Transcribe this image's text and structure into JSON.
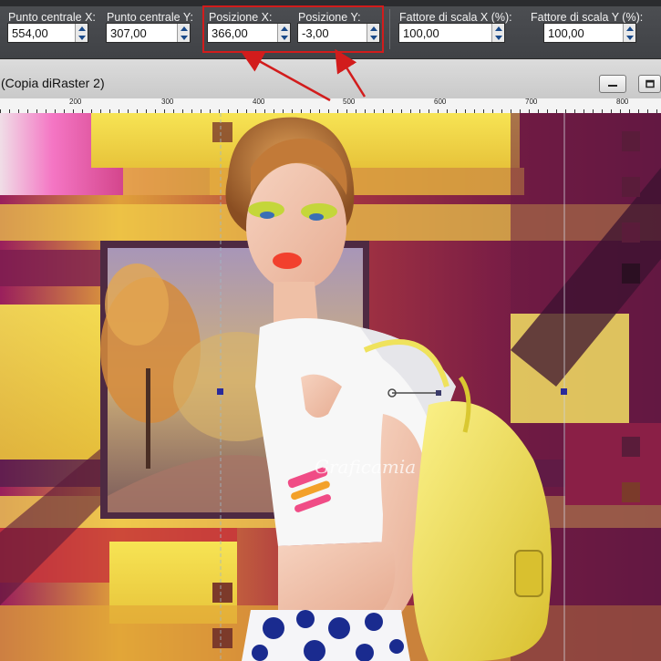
{
  "tool_options": {
    "center_x": {
      "label": "Punto centrale X:",
      "value": "554,00"
    },
    "center_y": {
      "label": "Punto centrale Y:",
      "value": "307,00"
    },
    "position_x": {
      "label": "Posizione X:",
      "value": "366,00"
    },
    "position_y": {
      "label": "Posizione Y:",
      "value": "-3,00"
    },
    "scale_x": {
      "label": "Fattore di scala X (%):",
      "value": "100,00"
    },
    "scale_y": {
      "label": "Fattore di scala Y (%):",
      "value": "100,00"
    }
  },
  "window": {
    "title": "(Copia diRaster 2)"
  },
  "ruler": {
    "labels": [
      "200",
      "300",
      "400",
      "500",
      "600",
      "700",
      "800"
    ]
  },
  "watermark": {
    "text": "Graficamia"
  },
  "colors": {
    "highlight": "#d21c1c",
    "toolbar": "#45474b",
    "titlebar": "#d4d4d4"
  }
}
